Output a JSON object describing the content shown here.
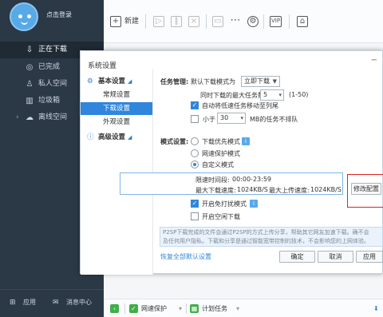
{
  "sidebar": {
    "login_label": "点击登录",
    "items": [
      {
        "label": "正在下载",
        "icon": "download-icon"
      },
      {
        "label": "已完成",
        "icon": "check-circle-icon"
      },
      {
        "label": "私人空间",
        "icon": "person-icon"
      },
      {
        "label": "垃圾箱",
        "icon": "trash-icon"
      },
      {
        "label": "离线空间",
        "icon": "cloud-icon"
      }
    ],
    "bottom": {
      "apps_label": "应用",
      "message_label": "消息中心"
    }
  },
  "toolbar": {
    "new_label": "新建",
    "vip_label": "VIP"
  },
  "dialog": {
    "title": "系统设置",
    "close": "×",
    "tree": {
      "basic": "基本设置",
      "basic_children": [
        "常规设置",
        "下载设置",
        "外观设置"
      ],
      "advanced": "高级设置"
    },
    "task_mgmt": {
      "section": "任务管理:",
      "default_mode_label": "默认下载模式为",
      "default_mode_value": "立即下载",
      "max_tasks_label": "同时下载的最大任务数",
      "max_tasks_value": "5",
      "max_tasks_range": "(1-50)",
      "auto_move_label": "自动将低速任务移动至列尾",
      "auto_move_checked": true,
      "less_than_label": "小于",
      "less_than_value": "30",
      "less_than_suffix": "MB的任务不排队",
      "less_than_checked": false
    },
    "mode": {
      "section": "模式设置:",
      "options": [
        "下载优先模式",
        "网速保护模式",
        "自定义模式"
      ],
      "selected_index": 2,
      "speed_period_label": "限速时间段:",
      "speed_period_value": "00:00-23:59",
      "max_dl_label": "最大下载速度:",
      "max_dl_value": "1024KB/S",
      "max_ul_label": "最大上传速度:",
      "max_ul_value": "1024KB/S",
      "modify_button": "修改配置",
      "anti_disturb_label": "开启免打扰模式",
      "anti_disturb_checked": true,
      "idle_download_label": "开启空闲下载",
      "idle_download_checked": false
    },
    "notice": {
      "line1": "P2SP下载完成的文件会通过P2SP的方式上传分享，帮助其它网友加速下载。确不会",
      "line2": "及任何用户隐私。下载和分享是通过智能宽带控制的技术，不会影响您的上网体验。"
    },
    "restore_link": "恢复全部默认设置",
    "buttons": {
      "ok": "确定",
      "cancel": "取消",
      "apply": "应用"
    }
  },
  "statusbar": {
    "protect_label": "网速保护",
    "schedule_label": "计划任务"
  },
  "colors": {
    "sidebar_bg": "#2b3846",
    "accent": "#2f86dc",
    "highlight_border": "#e02020",
    "protect_icon": "#3fae49"
  }
}
